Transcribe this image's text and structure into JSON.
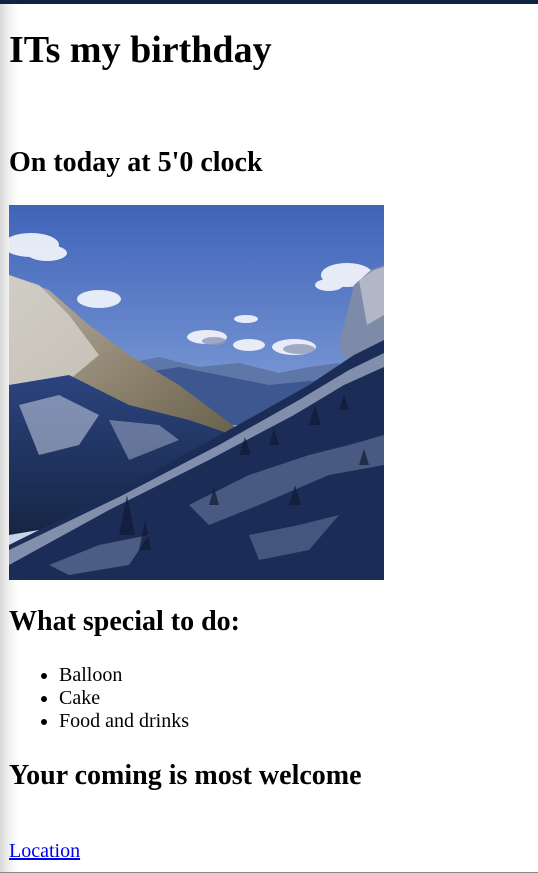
{
  "page": {
    "title": "ITs my birthday",
    "time_heading": "On today at 5'0 clock",
    "special_heading": "What special to do:",
    "special_items": [
      "Balloon",
      "Cake",
      "Food and drinks"
    ],
    "welcome_heading": "Your coming is most welcome",
    "location_link": "Location"
  },
  "colors": {
    "top_bar": "#0d2440",
    "link": "#0000ee"
  }
}
